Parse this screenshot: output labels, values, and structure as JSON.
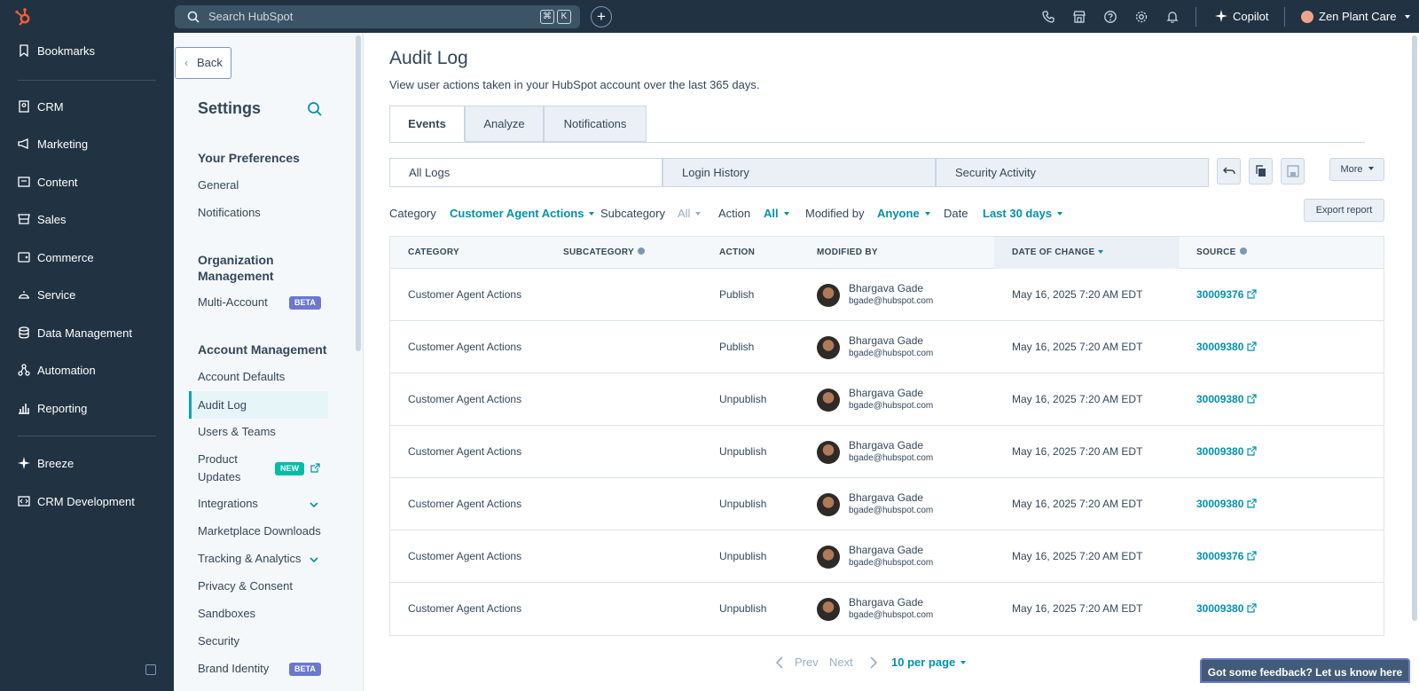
{
  "topbar": {
    "search_placeholder": "Search HubSpot",
    "kbd_cmd": "⌘",
    "kbd_k": "K",
    "add_label": "+",
    "copilot_label": "Copilot",
    "account_name": "Zen Plant Care"
  },
  "leftnav": {
    "items": [
      {
        "label": "Bookmarks",
        "icon": "bookmark-icon"
      },
      {
        "label": "CRM",
        "icon": "crm-icon"
      },
      {
        "label": "Marketing",
        "icon": "megaphone-icon"
      },
      {
        "label": "Content",
        "icon": "content-icon"
      },
      {
        "label": "Sales",
        "icon": "sales-icon"
      },
      {
        "label": "Commerce",
        "icon": "commerce-icon"
      },
      {
        "label": "Service",
        "icon": "service-icon"
      },
      {
        "label": "Data Management",
        "icon": "database-icon"
      },
      {
        "label": "Automation",
        "icon": "automation-icon"
      },
      {
        "label": "Reporting",
        "icon": "chart-icon"
      },
      {
        "label": "Breeze",
        "icon": "sparkle-icon"
      },
      {
        "label": "CRM Development",
        "icon": "code-icon"
      }
    ]
  },
  "settings": {
    "back_label": "Back",
    "title": "Settings",
    "section_preferences": "Your Preferences",
    "general": "General",
    "notifications": "Notifications",
    "section_org_line1": "Organization",
    "section_org_line2": "Management",
    "multi_account": "Multi-Account",
    "beta": "BETA",
    "section_account": "Account Management",
    "account_defaults": "Account Defaults",
    "audit_log": "Audit Log",
    "users_teams": "Users & Teams",
    "product_updates_line1": "Product",
    "product_updates_line2": "Updates",
    "new": "NEW",
    "integrations": "Integrations",
    "marketplace_downloads": "Marketplace Downloads",
    "tracking_analytics": "Tracking & Analytics",
    "privacy_consent": "Privacy & Consent",
    "sandboxes": "Sandboxes",
    "security": "Security",
    "brand_identity": "Brand Identity"
  },
  "main": {
    "title": "Audit Log",
    "subtitle": "View user actions taken in your HubSpot account over the last 365 days.",
    "tabs": [
      "Events",
      "Analyze",
      "Notifications"
    ],
    "subtabs": [
      "All Logs",
      "Login History",
      "Security Activity"
    ],
    "more_label": "More",
    "export_label": "Export report",
    "filters": {
      "category_label": "Category",
      "category_value": "Customer Agent Actions",
      "subcategory_label": "Subcategory",
      "subcategory_value": "All",
      "action_label": "Action",
      "action_value": "All",
      "modified_label": "Modified by",
      "modified_value": "Anyone",
      "date_label": "Date",
      "date_value": "Last 30 days"
    },
    "columns": [
      "CATEGORY",
      "SUBCATEGORY",
      "ACTION",
      "MODIFIED BY",
      "DATE OF CHANGE",
      "SOURCE"
    ],
    "rows": [
      {
        "category": "Customer Agent Actions",
        "action": "Publish",
        "name": "Bhargava Gade",
        "email": "bgade@hubspot.com",
        "date": "May 16, 2025 7:20 AM EDT",
        "source": "30009376"
      },
      {
        "category": "Customer Agent Actions",
        "action": "Publish",
        "name": "Bhargava Gade",
        "email": "bgade@hubspot.com",
        "date": "May 16, 2025 7:20 AM EDT",
        "source": "30009380"
      },
      {
        "category": "Customer Agent Actions",
        "action": "Unpublish",
        "name": "Bhargava Gade",
        "email": "bgade@hubspot.com",
        "date": "May 16, 2025 7:20 AM EDT",
        "source": "30009380"
      },
      {
        "category": "Customer Agent Actions",
        "action": "Unpublish",
        "name": "Bhargava Gade",
        "email": "bgade@hubspot.com",
        "date": "May 16, 2025 7:20 AM EDT",
        "source": "30009380"
      },
      {
        "category": "Customer Agent Actions",
        "action": "Unpublish",
        "name": "Bhargava Gade",
        "email": "bgade@hubspot.com",
        "date": "May 16, 2025 7:20 AM EDT",
        "source": "30009380"
      },
      {
        "category": "Customer Agent Actions",
        "action": "Unpublish",
        "name": "Bhargava Gade",
        "email": "bgade@hubspot.com",
        "date": "May 16, 2025 7:20 AM EDT",
        "source": "30009376"
      },
      {
        "category": "Customer Agent Actions",
        "action": "Unpublish",
        "name": "Bhargava Gade",
        "email": "bgade@hubspot.com",
        "date": "May 16, 2025 7:20 AM EDT",
        "source": "30009380"
      }
    ],
    "pager": {
      "prev": "Prev",
      "next": "Next",
      "per_page": "10 per page"
    },
    "feedback": "Got some feedback? Let us know here"
  }
}
